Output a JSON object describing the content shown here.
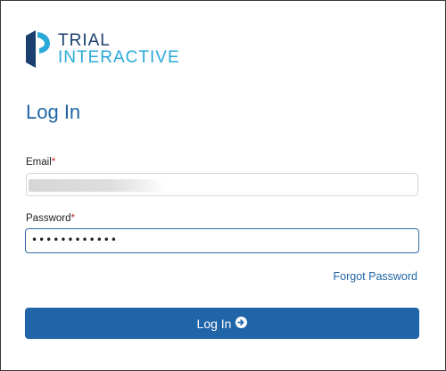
{
  "brand": {
    "line1": "TRIAL",
    "line2": "INTERACTIVE",
    "primary_color": "#1b3f6e",
    "accent_color": "#29a9d8"
  },
  "page": {
    "title": "Log In"
  },
  "form": {
    "email_label": "Email",
    "email_value": "",
    "password_label": "Password",
    "password_value": "••••••••••••",
    "required_marker": "*",
    "forgot_link": "Forgot Password",
    "submit_label": "Log In",
    "submit_icon": "arrow-circle-right-icon",
    "button_color": "#2065a8"
  }
}
